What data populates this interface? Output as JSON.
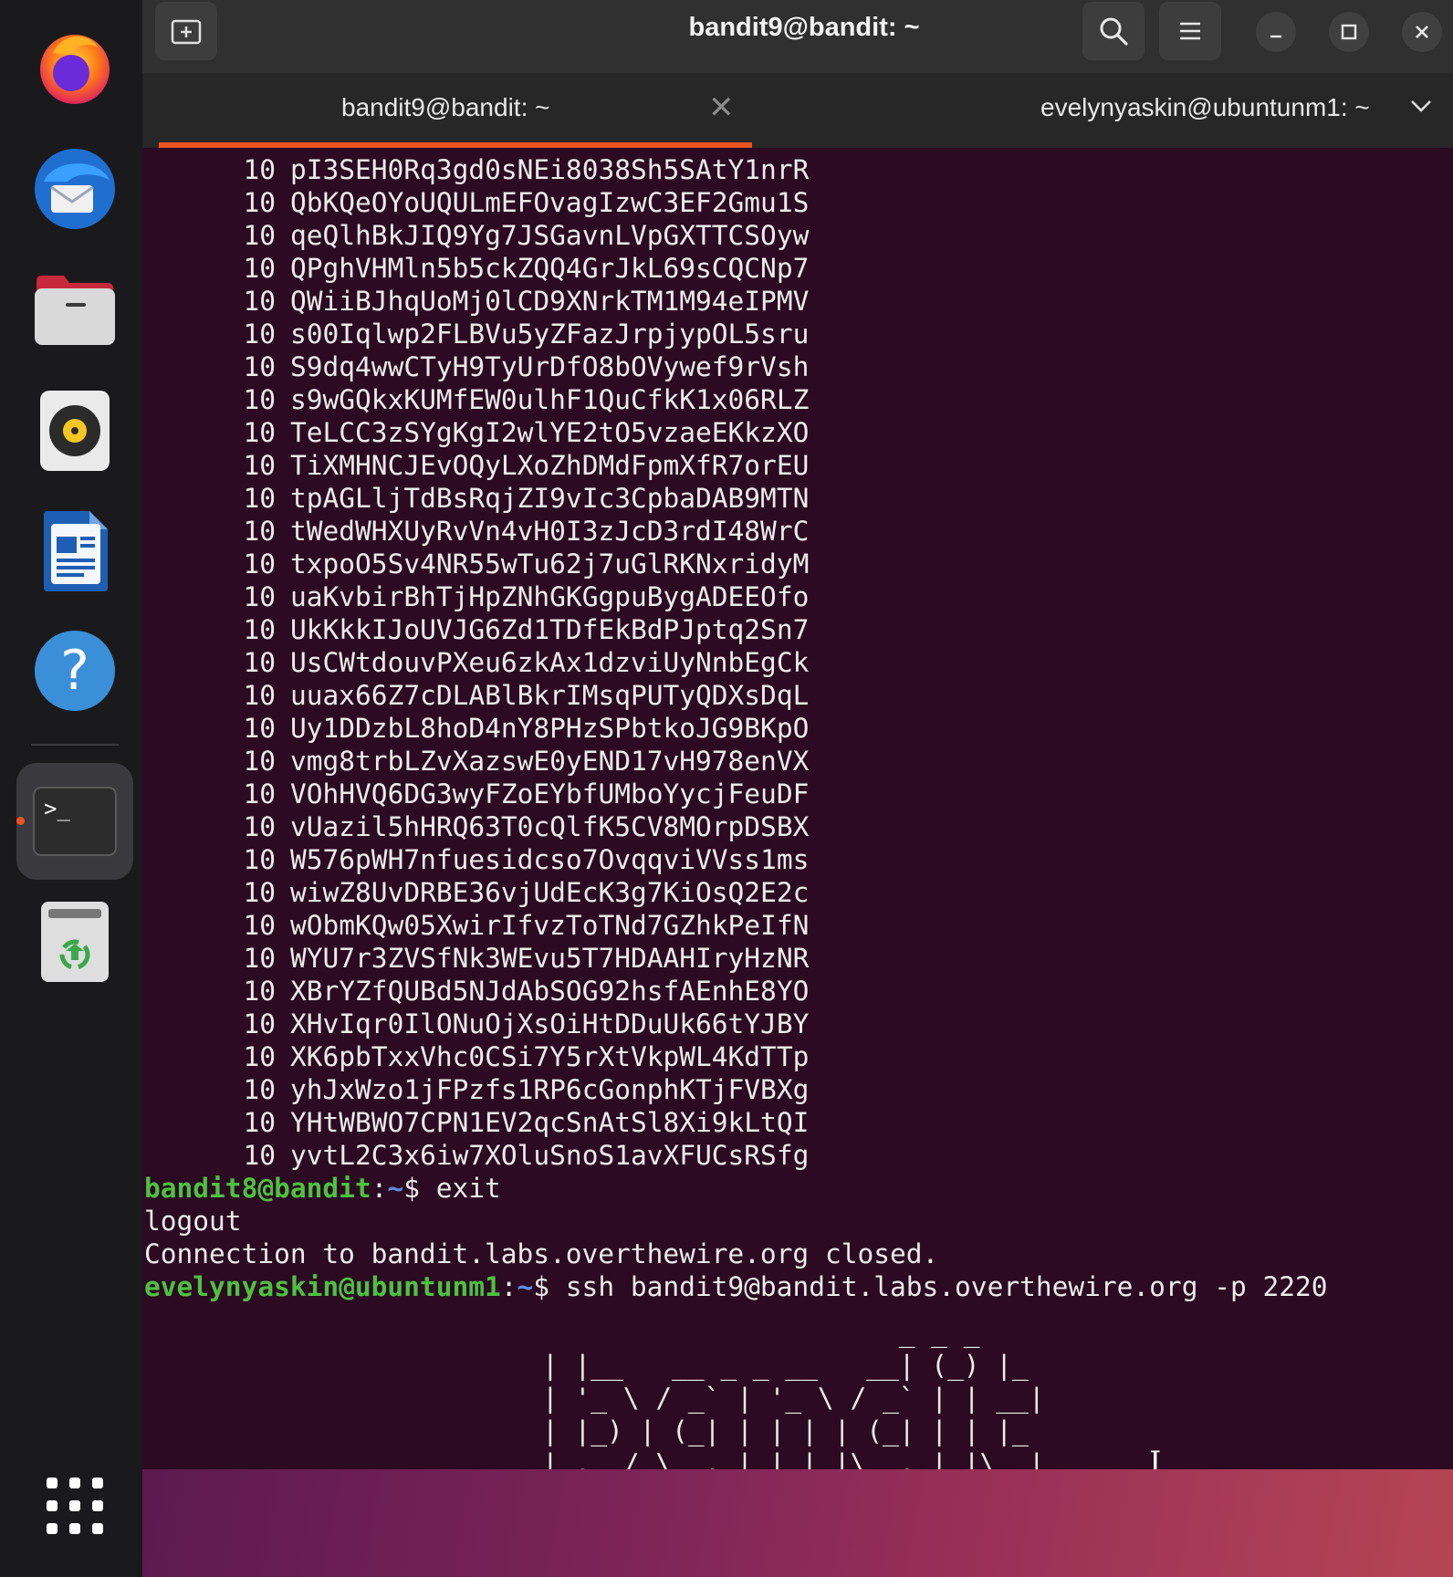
{
  "window": {
    "title": "bandit9@bandit: ~"
  },
  "tabs": [
    {
      "label": "bandit9@bandit: ~",
      "active": true
    },
    {
      "label": "evelynyaskin@ubuntunm1: ~",
      "active": false
    }
  ],
  "dock": {
    "items": [
      "firefox-icon",
      "thunderbird-icon",
      "files-icon",
      "rhythmbox-icon",
      "writer-icon",
      "help-icon",
      "terminal-icon",
      "trash-icon",
      "show-apps-icon"
    ],
    "accent_color": "#e95420"
  },
  "terminal": {
    "count_lines": [
      {
        "count": "10",
        "text": "pI3SEH0Rq3gd0sNEi8038Sh5SAtY1nrR"
      },
      {
        "count": "10",
        "text": "QbKQeOYoUQULmEFOvagIzwC3EF2Gmu1S"
      },
      {
        "count": "10",
        "text": "qeQlhBkJIQ9Yg7JSGavnLVpGXTTCSOyw"
      },
      {
        "count": "10",
        "text": "QPghVHMln5b5ckZQQ4GrJkL69sCQCNp7"
      },
      {
        "count": "10",
        "text": "QWiiBJhqUoMj0lCD9XNrkTM1M94eIPMV"
      },
      {
        "count": "10",
        "text": "s00Iqlwp2FLBVu5yZFazJrpjypOL5sru"
      },
      {
        "count": "10",
        "text": "S9dq4wwCTyH9TyUrDfO8bOVywef9rVsh"
      },
      {
        "count": "10",
        "text": "s9wGQkxKUMfEW0ulhF1QuCfkK1x06RLZ"
      },
      {
        "count": "10",
        "text": "TeLCC3zSYgKgI2wlYE2tO5vzaeEKkzXO"
      },
      {
        "count": "10",
        "text": "TiXMHNCJEvOQyLXoZhDMdFpmXfR7orEU"
      },
      {
        "count": "10",
        "text": "tpAGLljTdBsRqjZI9vIc3CpbaDAB9MTN"
      },
      {
        "count": "10",
        "text": "tWedWHXUyRvVn4vH0I3zJcD3rdI48WrC"
      },
      {
        "count": "10",
        "text": "txpoO5Sv4NR55wTu62j7uGlRKNxridyM"
      },
      {
        "count": "10",
        "text": "uaKvbirBhTjHpZNhGKGgpuBygADEEOfo"
      },
      {
        "count": "10",
        "text": "UkKkkIJoUVJG6Zd1TDfEkBdPJptq2Sn7"
      },
      {
        "count": "10",
        "text": "UsCWtdouvPXeu6zkAx1dzviUyNnbEgCk"
      },
      {
        "count": "10",
        "text": "uuax66Z7cDLABlBkrIMsqPUTyQDXsDqL"
      },
      {
        "count": "10",
        "text": "Uy1DDzbL8hoD4nY8PHzSPbtkoJG9BKpO"
      },
      {
        "count": "10",
        "text": "vmg8trbLZvXazswE0yEND17vH978enVX"
      },
      {
        "count": "10",
        "text": "VOhHVQ6DG3wyFZoEYbfUMboYycjFeuDF"
      },
      {
        "count": "10",
        "text": "vUazil5hHRQ63T0cQlfK5CV8MOrpDSBX"
      },
      {
        "count": "10",
        "text": "W576pWH7nfuesidcso7OvqqviVVss1ms"
      },
      {
        "count": "10",
        "text": "wiwZ8UvDRBE36vjUdEcK3g7KiOsQ2E2c"
      },
      {
        "count": "10",
        "text": "wObmKQw05XwirIfvzToTNd7GZhkPeIfN"
      },
      {
        "count": "10",
        "text": "WYU7r3ZVSfNk3WEvu5T7HDAAHIryHzNR"
      },
      {
        "count": "10",
        "text": "XBrYZfQUBd5NJdAbSOG92hsfAEnhE8YO"
      },
      {
        "count": "10",
        "text": "XHvIqr0IlONuOjXsOiHtDDuUk66tYJBY"
      },
      {
        "count": "10",
        "text": "XK6pbTxxVhc0CSi7Y5rXtVkpWL4KdTTp"
      },
      {
        "count": "10",
        "text": "yhJxWzo1jFPzfs1RP6cGonphKTjFVBXg"
      },
      {
        "count": "10",
        "text": "YHtWBWO7CPN1EV2qcSnAtSl8Xi9kLtQI"
      },
      {
        "count": "10",
        "text": "yvtL2C3x6iw7XOluSnoS1avXFUCsRSfg"
      }
    ],
    "prompt1": {
      "user_host": "bandit8@bandit",
      "sep": ":",
      "path": "~",
      "sym": "$ ",
      "command": "exit"
    },
    "logout_text": "logout",
    "closed_text": "Connection to bandit.labs.overthewire.org closed.",
    "prompt2": {
      "user_host": "evelynyaskin@ubuntunm1",
      "sep": ":",
      "path": "~",
      "sym": "$ ",
      "command": "ssh bandit9@bandit.labs.overthewire.org -p 2220"
    },
    "banner_lines": [
      "                      _ _ _",
      "| |__   __ _ _ __   __| (_) |_",
      "| '_ \\ / _` | '_ \\ / _` | | __|",
      "| |_) | (_| | | | | (_| | | |_",
      "|_.__/ \\__,_|_| |_|\\__,_|_|\\__|"
    ]
  },
  "colors": {
    "terminal_bg": "#2c0a22",
    "prompt_user": "#4cc23f",
    "prompt_path": "#5a8ee6",
    "tab_accent": "#e95420"
  }
}
